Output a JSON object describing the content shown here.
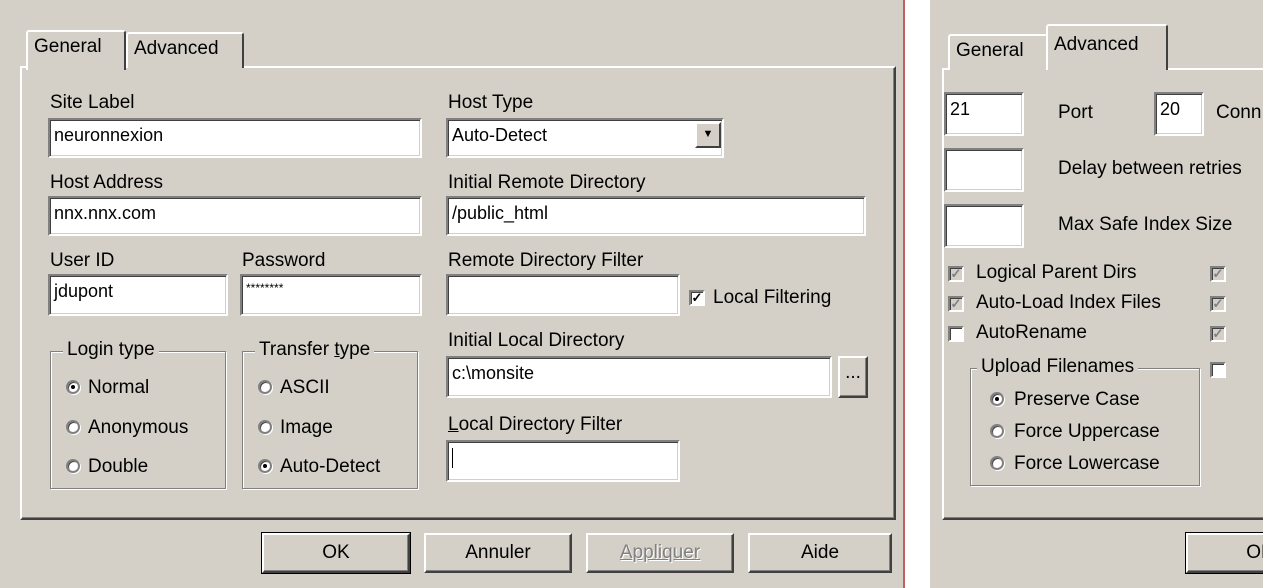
{
  "left_dialog": {
    "tabs": [
      "General",
      "Advanced"
    ],
    "active_tab": "General",
    "site_label": {
      "label": "Site Label",
      "value": "neuronnexion"
    },
    "host_address": {
      "label": "Host Address",
      "value": "nnx.nnx.com"
    },
    "user_id": {
      "label": "User ID",
      "value": "jdupont"
    },
    "password": {
      "label": "Password",
      "value": "********"
    },
    "host_type": {
      "label": "Host Type",
      "value": "Auto-Detect"
    },
    "initial_remote_dir": {
      "label": "Initial Remote Directory",
      "value": "/public_html"
    },
    "remote_dir_filter": {
      "label": "Remote Directory Filter",
      "value": ""
    },
    "local_filtering": {
      "label": "Local Filtering",
      "checked": true
    },
    "initial_local_dir": {
      "label": "Initial Local Directory",
      "value": "c:\\monsite",
      "browse": "..."
    },
    "local_dir_filter": {
      "label": "Local Directory Filter",
      "value": ""
    },
    "login_type": {
      "title": "Login type",
      "options": [
        "Normal",
        "Anonymous",
        "Double"
      ],
      "selected": "Normal"
    },
    "transfer_type": {
      "title": "Transfer type",
      "options": [
        "ASCII",
        "Image",
        "Auto-Detect"
      ],
      "selected": "Auto-Detect"
    },
    "buttons": {
      "ok": "OK",
      "cancel": "Annuler",
      "apply": "Appliquer",
      "help": "Aide"
    }
  },
  "right_dialog": {
    "tabs": [
      "General",
      "Advanced"
    ],
    "active_tab": "Advanced",
    "port": {
      "value": "21",
      "label": "Port"
    },
    "conn": {
      "value": "20",
      "label": "Conn"
    },
    "delay": {
      "value": "",
      "label": "Delay between retries"
    },
    "max_index": {
      "value": "",
      "label": "Max Safe Index Size"
    },
    "checks": [
      {
        "label": "Logical Parent Dirs",
        "checked": true,
        "grey": true
      },
      {
        "label": "Auto-Load Index Files",
        "checked": true,
        "grey": true
      },
      {
        "label": "AutoRename",
        "checked": false,
        "grey": false
      }
    ],
    "right_checks": [
      {
        "checked": true,
        "grey": true
      },
      {
        "checked": true,
        "grey": true
      },
      {
        "checked": true,
        "grey": true
      },
      {
        "checked": false,
        "grey": false
      }
    ],
    "upload_filenames": {
      "title": "Upload Filenames",
      "options": [
        "Preserve Case",
        "Force Uppercase",
        "Force Lowercase"
      ],
      "selected": "Preserve Case"
    },
    "ok_button": "OK"
  },
  "colors": {
    "face": "#d4d0c8",
    "shadow": "#808080",
    "highlight": "#ffffff",
    "separator": "#c06060"
  }
}
